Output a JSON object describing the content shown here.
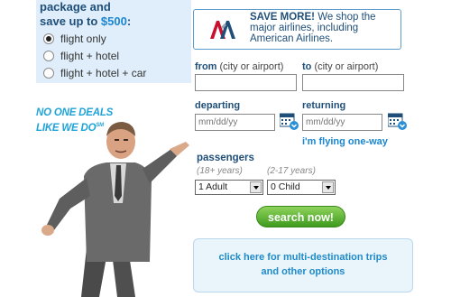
{
  "promo": {
    "line1": "package and",
    "line2_prefix": "save up to ",
    "amount": "$500",
    "line2_suffix": ":"
  },
  "trip_options": [
    {
      "label": "flight only",
      "selected": true
    },
    {
      "label": "flight + hotel",
      "selected": false
    },
    {
      "label": "flight + hotel + car",
      "selected": false
    }
  ],
  "tagline": {
    "line1": "NO ONE DEALS",
    "line2": "LIKE WE DO",
    "mark": "SM"
  },
  "airline_banner": {
    "logo_text": "AA",
    "headline": "SAVE MORE!",
    "body": " We shop the major airlines, including American Airlines."
  },
  "from": {
    "label": "from",
    "hint": "(city or airport)",
    "value": ""
  },
  "to": {
    "label": "to",
    "hint": "(city or airport)",
    "value": ""
  },
  "departing": {
    "label": "departing",
    "placeholder": "mm/dd/yy"
  },
  "returning": {
    "label": "returning",
    "placeholder": "mm/dd/yy"
  },
  "one_way_link": "i'm flying one-way",
  "passengers": {
    "label": "passengers",
    "adult_hint": "(18+ years)",
    "child_hint": "(2-17 years)",
    "adult_value": "1 Adult",
    "child_value": "0 Child"
  },
  "search_button": "search now!",
  "multi_destination": {
    "line1": "click here for multi-destination trips",
    "line2": "and other options"
  },
  "colors": {
    "brand": "#1f4f79",
    "accent": "#1a86d0",
    "button": "#3e9b1e"
  }
}
